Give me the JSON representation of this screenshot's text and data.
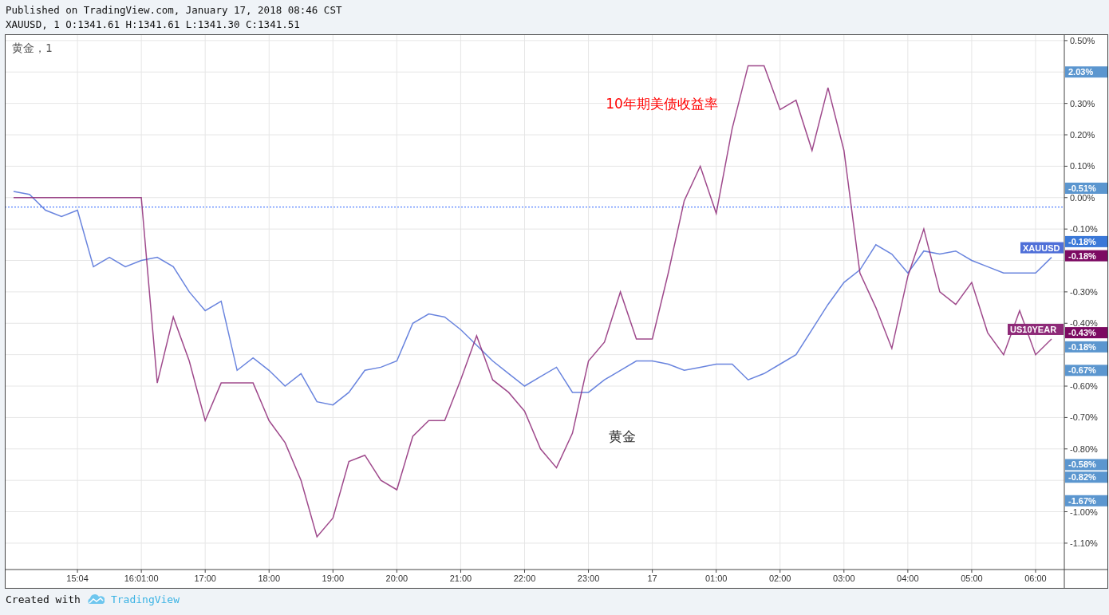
{
  "header": {
    "published": "Published on TradingView.com, January 17, 2018 08:46 CST",
    "ohlc": "XAUUSD, 1 O:1341.61 H:1341.61 L:1341.30 C:1341.51"
  },
  "chart": {
    "legend": "黄金，1",
    "labels": [
      {
        "text": "10年期美债收益率",
        "color": "#ff0000"
      },
      {
        "text": "黄金",
        "color": "#333333"
      }
    ],
    "price_labels": [
      {
        "text": "2.03%",
        "color": "#5b96cf"
      },
      {
        "text": "-0.51%",
        "color": "#5b96cf"
      },
      {
        "text": "-0.18%",
        "color": "#3a78d8"
      },
      {
        "text": "-0.18%",
        "color": "#7c0a62"
      },
      {
        "text": "-0.43%",
        "color": "#7c0a62"
      },
      {
        "text": "-0.18%",
        "color": "#5b96cf"
      },
      {
        "text": "-0.67%",
        "color": "#5b96cf"
      },
      {
        "text": "-0.58%",
        "color": "#5b96cf"
      },
      {
        "text": "-0.82%",
        "color": "#5b96cf"
      },
      {
        "text": "-1.67%",
        "color": "#5b96cf"
      }
    ],
    "chart_data": {
      "type": "line",
      "ylim": [
        -1.184,
        0.52
      ],
      "categories": [
        null,
        null,
        null,
        null,
        "15:04",
        null,
        null,
        null,
        "16:01:00",
        null,
        null,
        null,
        "17:00",
        null,
        null,
        null,
        "18:00",
        null,
        null,
        null,
        "19:00",
        null,
        null,
        null,
        "20:00",
        null,
        null,
        null,
        "21:00",
        null,
        null,
        null,
        "22:00",
        null,
        null,
        null,
        "23:00",
        null,
        null,
        null,
        "17",
        null,
        null,
        null,
        "01:00",
        null,
        null,
        null,
        "02:00",
        null,
        null,
        null,
        "03:00",
        null,
        null,
        null,
        "04:00",
        null,
        null,
        null,
        "05:00",
        null,
        null,
        null,
        "06:00",
        null
      ],
      "yticks": [
        {
          "value": 0.5,
          "label": "0.50%"
        },
        {
          "value": 0.3,
          "label": "0.30%"
        },
        {
          "value": 0.2,
          "label": "0.20%"
        },
        {
          "value": 0.1,
          "label": "0.10%"
        },
        {
          "value": 0,
          "label": "0.00%"
        },
        {
          "value": -0.1,
          "label": "-0.10%"
        },
        {
          "value": -0.3,
          "label": "-0.30%"
        },
        {
          "value": -0.4,
          "label": "-0.40%"
        },
        {
          "value": -0.6,
          "label": "-0.60%"
        },
        {
          "value": -0.7,
          "label": "-0.70%"
        },
        {
          "value": -0.8,
          "label": "-0.80%"
        },
        {
          "value": -1.0,
          "label": "-1.00%"
        },
        {
          "value": -1.1,
          "label": "-1.10%"
        }
      ],
      "grid": true,
      "ref_lines": [
        {
          "axis": "y",
          "value": -0.03
        }
      ],
      "series": [
        {
          "name": "XAUUSD",
          "color": "#4f6fd8",
          "values": [
            0.02,
            0.01,
            -0.04,
            -0.06,
            -0.04,
            -0.22,
            -0.19,
            -0.22,
            -0.2,
            -0.19,
            -0.22,
            -0.3,
            -0.36,
            -0.33,
            -0.55,
            -0.51,
            -0.55,
            -0.6,
            -0.56,
            -0.65,
            -0.66,
            -0.62,
            -0.55,
            -0.54,
            -0.52,
            -0.4,
            -0.37,
            -0.38,
            -0.42,
            -0.47,
            -0.52,
            -0.56,
            -0.6,
            -0.57,
            -0.54,
            -0.62,
            -0.62,
            -0.58,
            -0.55,
            -0.52,
            -0.52,
            -0.53,
            -0.55,
            -0.54,
            -0.53,
            -0.53,
            -0.58,
            -0.56,
            -0.53,
            -0.5,
            -0.42,
            -0.34,
            -0.27,
            -0.23,
            -0.15,
            -0.18,
            -0.24,
            -0.17,
            -0.18,
            -0.17,
            -0.2,
            -0.22,
            -0.24,
            -0.24,
            -0.24,
            -0.19
          ]
        },
        {
          "name": "US10YEAR",
          "color": "#8e2a78",
          "values": [
            0,
            0,
            0,
            0,
            0,
            0,
            0,
            0,
            0,
            -0.59,
            -0.38,
            -0.52,
            -0.71,
            -0.59,
            -0.59,
            -0.59,
            -0.71,
            -0.78,
            -0.9,
            -1.08,
            -1.02,
            -0.84,
            -0.82,
            -0.9,
            -0.93,
            -0.76,
            -0.71,
            -0.71,
            -0.58,
            -0.44,
            -0.58,
            -0.62,
            -0.68,
            -0.8,
            -0.86,
            -0.75,
            -0.52,
            -0.46,
            -0.3,
            -0.45,
            -0.45,
            -0.24,
            -0.01,
            0.1,
            -0.05,
            0.22,
            0.42,
            0.42,
            0.28,
            0.31,
            0.15,
            0.35,
            0.15,
            -0.24,
            -0.35,
            -0.48,
            -0.25,
            -0.1,
            -0.3,
            -0.34,
            -0.27,
            -0.43,
            -0.5,
            -0.36,
            -0.5,
            -0.45
          ]
        }
      ]
    }
  },
  "footer": {
    "created_with": "Created with",
    "brand": "TradingView"
  }
}
